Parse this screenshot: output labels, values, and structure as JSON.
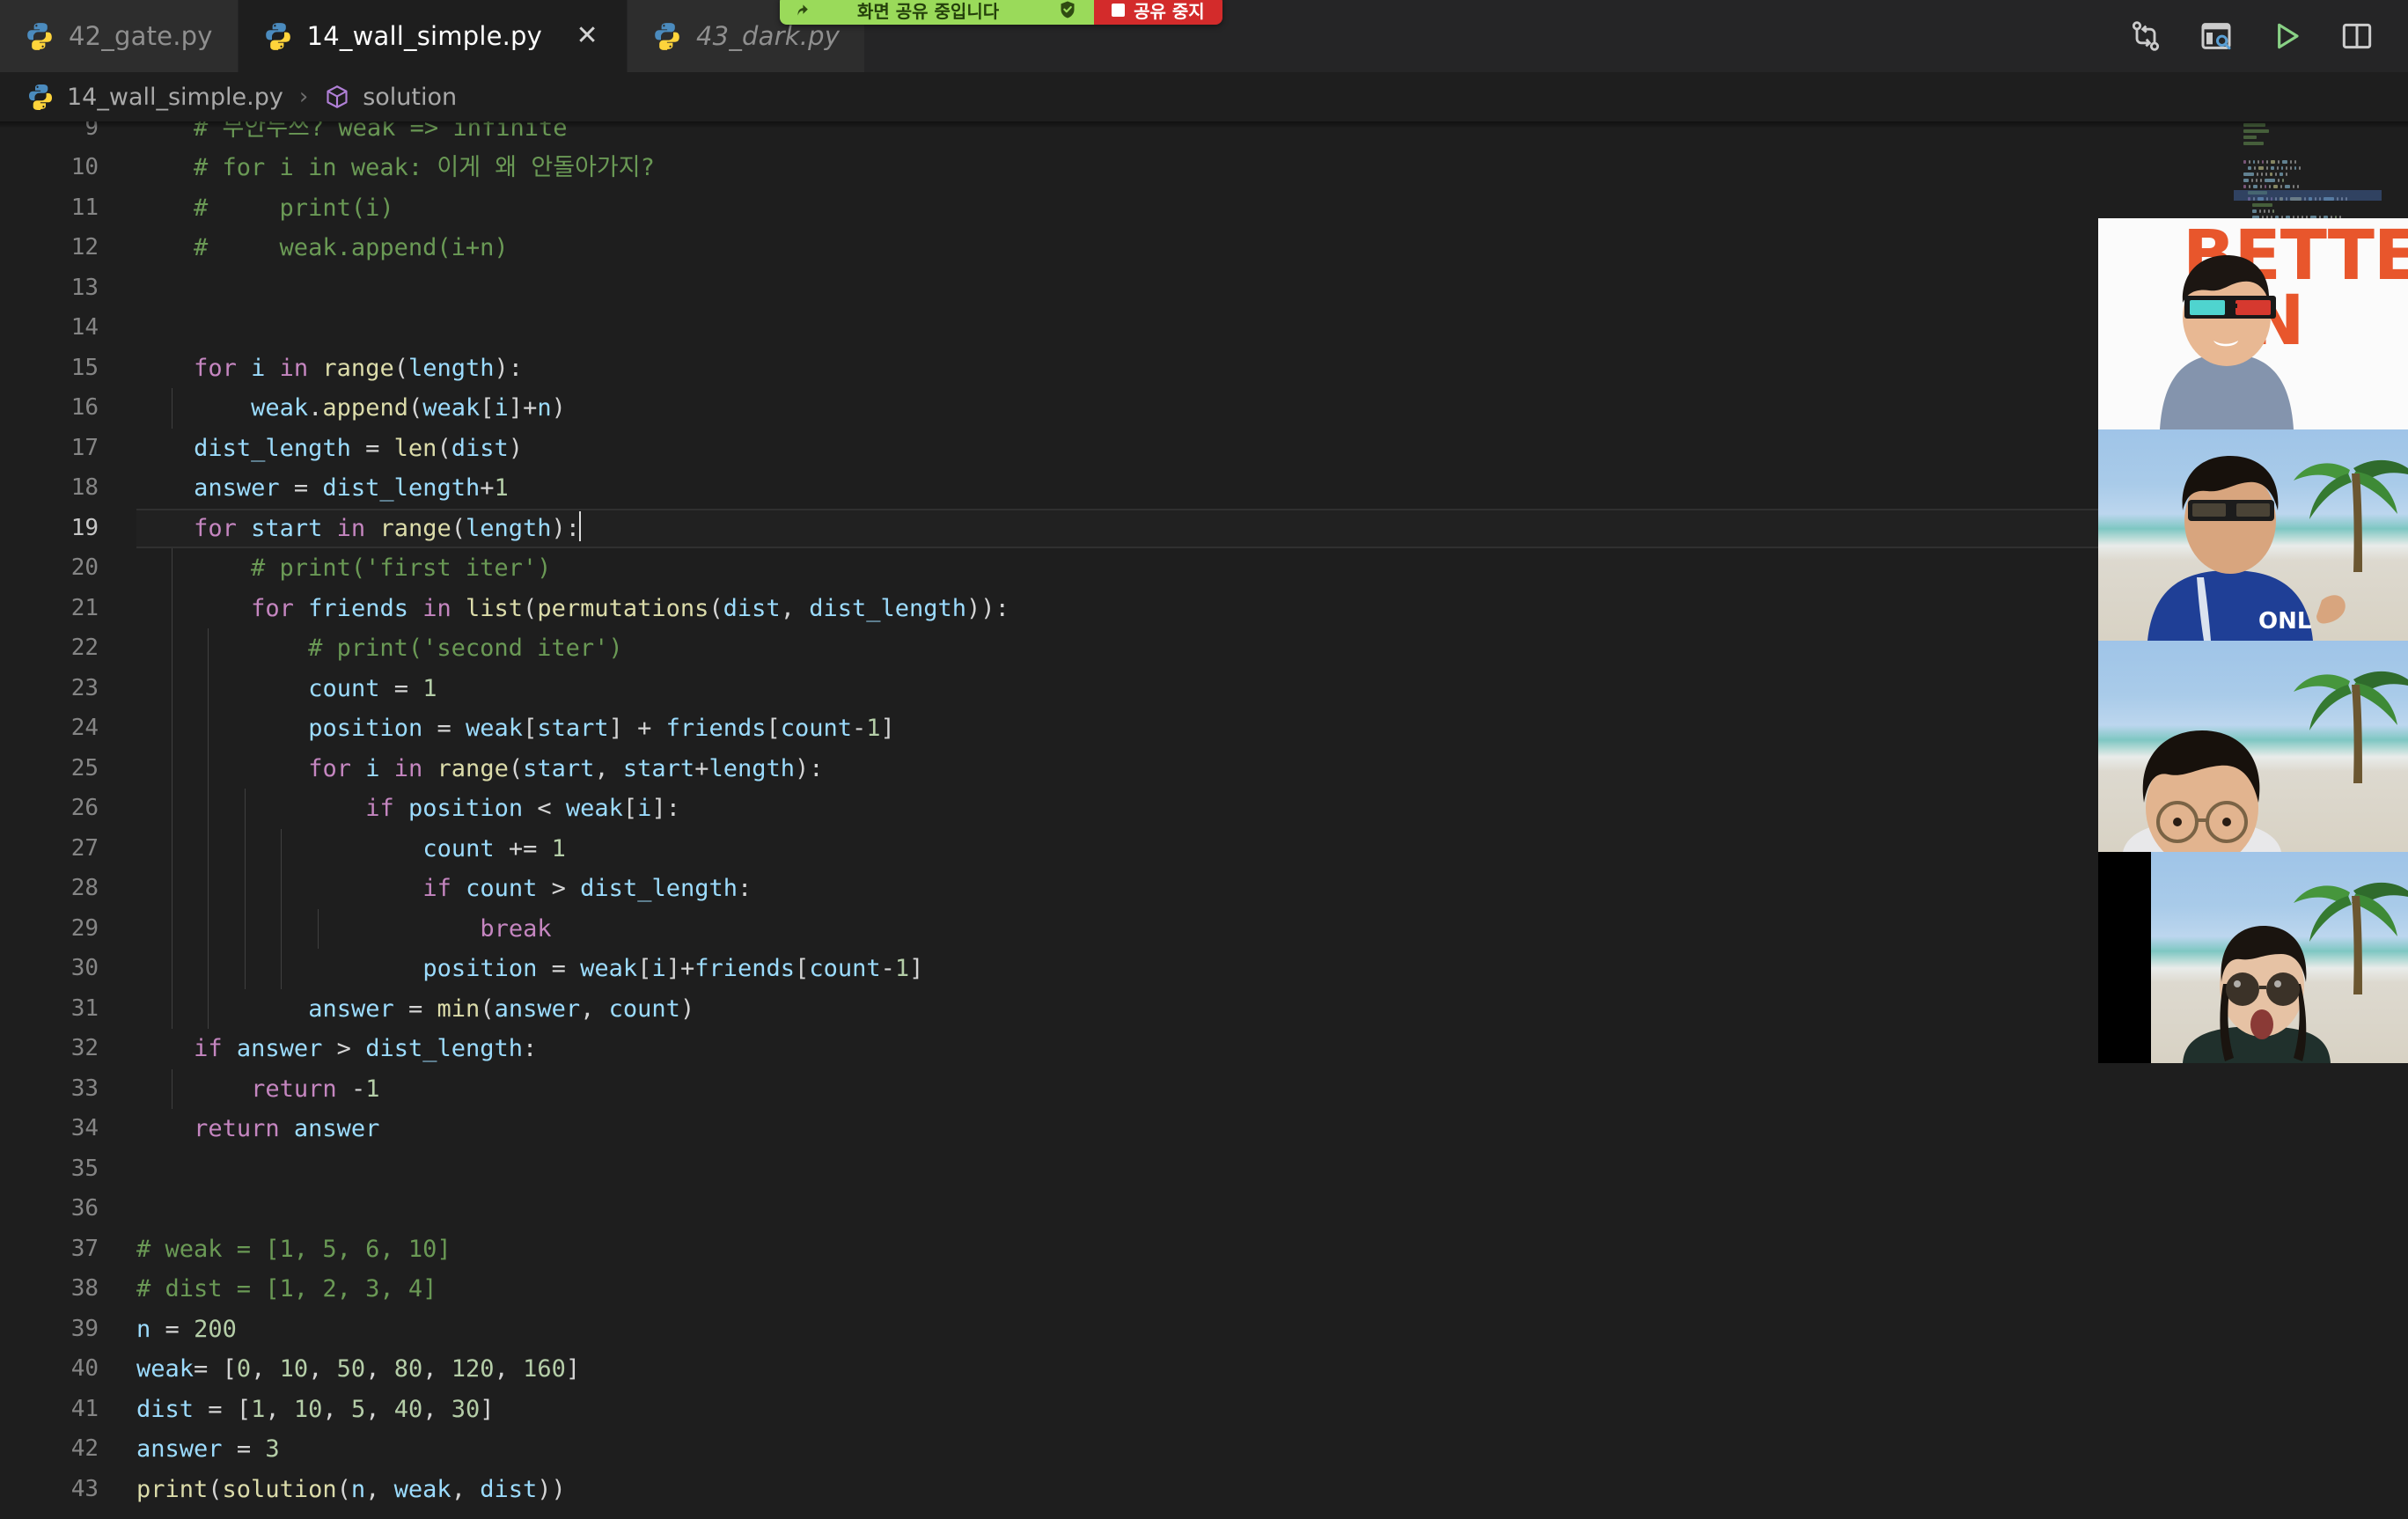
{
  "window": {
    "app": "Visual Studio Code",
    "theme_bg": "#1e1e1e",
    "accent": "#007acc"
  },
  "tabs": [
    {
      "label": "42_gate.py",
      "icon": "python-icon",
      "active": false,
      "italic": false,
      "closable": false
    },
    {
      "label": "14_wall_simple.py",
      "icon": "python-icon",
      "active": true,
      "italic": false,
      "closable": true,
      "close_glyph": "✕"
    },
    {
      "label": "43_dark.py",
      "icon": "python-icon",
      "active": false,
      "italic": true,
      "closable": false
    }
  ],
  "tab_actions": [
    {
      "name": "compare-changes-icon",
      "title": "Compare Changes"
    },
    {
      "name": "open-changes-panel-icon",
      "title": "Open Changes"
    },
    {
      "name": "run-python-file-icon",
      "title": "Run Python File",
      "color": "#89D185"
    },
    {
      "name": "split-editor-icon",
      "title": "Split Editor Right"
    }
  ],
  "breadcrumb": {
    "file": "14_wall_simple.py",
    "separator": "›",
    "symbol": "solution",
    "symbol_icon": "cube-icon",
    "symbol_color": "#B180D7"
  },
  "share_banner": {
    "arrow_icon": "share-arrow-icon",
    "message": "화면 공유 중입니다",
    "shield_icon": "shield-check-icon",
    "stop_label": "공유 중지",
    "stop_icon": "stop-square-icon",
    "green": "#9ada5a",
    "red": "#d32b2b"
  },
  "editor": {
    "language": "Python",
    "active_line": 19,
    "cursor_line": 19,
    "cursor_column": 28,
    "first_visible_line": 9,
    "last_visible_line": 43,
    "lines": [
      {
        "n": 9,
        "indent": 1,
        "partial": true,
        "text": "# 무안누쓰? weak => infinite"
      },
      {
        "n": 10,
        "indent": 1,
        "text": "# for i in weak: 이게 왜 안돌아가지?"
      },
      {
        "n": 11,
        "indent": 1,
        "text": "#     print(i)"
      },
      {
        "n": 12,
        "indent": 1,
        "text": "#     weak.append(i+n)"
      },
      {
        "n": 13,
        "indent": 0,
        "text": ""
      },
      {
        "n": 14,
        "indent": 0,
        "text": ""
      },
      {
        "n": 15,
        "indent": 1,
        "text": "for i in range(length):"
      },
      {
        "n": 16,
        "indent": 2,
        "text": "weak.append(weak[i]+n)"
      },
      {
        "n": 17,
        "indent": 1,
        "text": "dist_length = len(dist)"
      },
      {
        "n": 18,
        "indent": 1,
        "text": "answer = dist_length+1"
      },
      {
        "n": 19,
        "indent": 1,
        "text": "for start in range(length):",
        "active": true,
        "cursor_at_end": true
      },
      {
        "n": 20,
        "indent": 2,
        "text": "# print('first iter')"
      },
      {
        "n": 21,
        "indent": 2,
        "text": "for friends in list(permutations(dist, dist_length)):"
      },
      {
        "n": 22,
        "indent": 3,
        "text": "# print('second iter')"
      },
      {
        "n": 23,
        "indent": 3,
        "text": "count = 1"
      },
      {
        "n": 24,
        "indent": 3,
        "text": "position = weak[start] + friends[count-1]"
      },
      {
        "n": 25,
        "indent": 3,
        "text": "for i in range(start, start+length):"
      },
      {
        "n": 26,
        "indent": 4,
        "text": "if position < weak[i]:"
      },
      {
        "n": 27,
        "indent": 5,
        "text": "count += 1"
      },
      {
        "n": 28,
        "indent": 5,
        "text": "if count > dist_length:"
      },
      {
        "n": 29,
        "indent": 6,
        "text": "break"
      },
      {
        "n": 30,
        "indent": 5,
        "text": "position = weak[i]+friends[count-1]"
      },
      {
        "n": 31,
        "indent": 3,
        "text": "answer = min(answer, count)"
      },
      {
        "n": 32,
        "indent": 1,
        "text": "if answer > dist_length:"
      },
      {
        "n": 33,
        "indent": 2,
        "text": "return -1"
      },
      {
        "n": 34,
        "indent": 1,
        "text": "return answer"
      },
      {
        "n": 35,
        "indent": 0,
        "text": ""
      },
      {
        "n": 36,
        "indent": 0,
        "text": ""
      },
      {
        "n": 37,
        "indent": 0,
        "text": "# weak = [1, 5, 6, 10]"
      },
      {
        "n": 38,
        "indent": 0,
        "text": "# dist = [1, 2, 3, 4]"
      },
      {
        "n": 39,
        "indent": 0,
        "text": "n = 200"
      },
      {
        "n": 40,
        "indent": 0,
        "text": "weak= [0, 10, 50, 80, 120, 160]"
      },
      {
        "n": 41,
        "indent": 0,
        "text": "dist = [1, 10, 5, 40, 30]"
      },
      {
        "n": 42,
        "indent": 0,
        "text": "answer = 3"
      },
      {
        "n": 43,
        "indent": 0,
        "text": "print(solution(n, weak, dist))"
      }
    ],
    "token_colors": {
      "comment": "#6A9955",
      "keyword": "#C586C0",
      "function": "#DCDCAA",
      "variable": "#9CDCFE",
      "number": "#B5CEA8",
      "builtin": "#4EC9B0",
      "string": "#CE9178",
      "plain": "#D4D4D4"
    }
  },
  "minimap": {
    "visible": true,
    "slider_color": "#46688c"
  },
  "video_tiles": [
    {
      "name": "video-tile-1",
      "speaking": true,
      "background": "poster-white",
      "poster_line1": "BETTER",
      "poster_line2": "AN",
      "accessory": "3d-glasses",
      "shirt": "#8494ad"
    },
    {
      "name": "video-tile-2",
      "speaking": false,
      "background": "beach",
      "accessory": "sunglasses",
      "shirt": "#1f3f96",
      "shirt_logo": "ONL"
    },
    {
      "name": "video-tile-3",
      "speaking": false,
      "background": "beach",
      "accessory": "round-glasses",
      "shirt": "#e8e8ea"
    },
    {
      "name": "video-tile-4",
      "speaking": false,
      "background": "beach",
      "accessory": "round-sunglasses",
      "shirt": "#20302c",
      "letterbox": true
    }
  ]
}
